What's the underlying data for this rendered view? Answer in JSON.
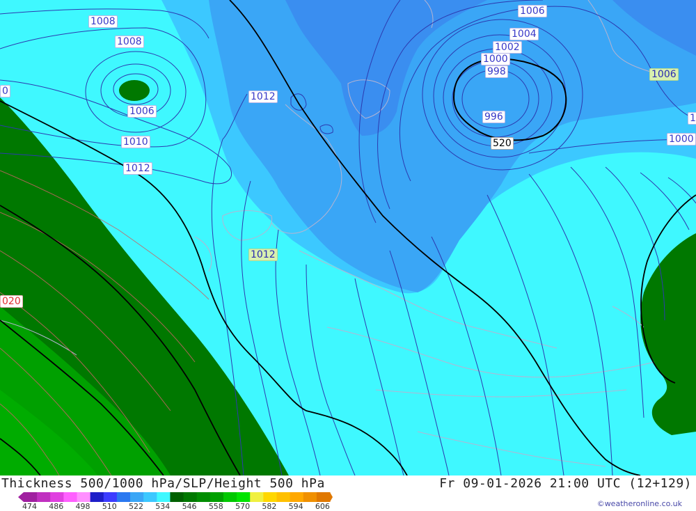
{
  "map": {
    "pressure_labels": [
      {
        "text": "1008",
        "style": "plain"
      },
      {
        "text": "1008",
        "style": "plain"
      },
      {
        "text": "1006",
        "style": "plain"
      },
      {
        "text": "1010",
        "style": "plain"
      },
      {
        "text": "1012",
        "style": "plain"
      },
      {
        "text": "1012",
        "style": "plain"
      },
      {
        "text": "1012",
        "style": "pale"
      },
      {
        "text": "1006",
        "style": "plain"
      },
      {
        "text": "1004",
        "style": "plain"
      },
      {
        "text": "1002",
        "style": "plain"
      },
      {
        "text": "1000",
        "style": "plain"
      },
      {
        "text": "998",
        "style": "plain"
      },
      {
        "text": "996",
        "style": "plain"
      },
      {
        "text": "1006",
        "style": "pale"
      },
      {
        "text": "1000",
        "style": "plain"
      },
      {
        "text": "0",
        "style": "plain"
      },
      {
        "text": "1",
        "style": "plain"
      }
    ],
    "thickness_labels": [
      {
        "text": "520",
        "style": "thick"
      },
      {
        "text": "020",
        "style": "red"
      }
    ],
    "colors": {
      "cyan": "#3ff8ff",
      "light_blue": "#3cc8ff",
      "mid_blue": "#3aa6f6",
      "blue": "#3a8ef0",
      "dark_green": "#007800",
      "green": "#00a000",
      "isobar": "#2c3ab0",
      "thickness_line": "#000000",
      "height_line": "#c86464",
      "coast": "#b4b4d2"
    }
  },
  "footer": {
    "title": "Thickness 500/1000 hPa/SLP/Height 500 hPa",
    "valid_time": "Fr 09-01-2026 21:00 UTC (12+129)",
    "credit": "©weatheronline.co.uk"
  },
  "legend": {
    "colors": [
      "#a020a0",
      "#c030c0",
      "#e040e0",
      "#ff60ff",
      "#ff90ff",
      "#1e1ec8",
      "#3c3cff",
      "#2a78f0",
      "#3aa6f6",
      "#3cc8ff",
      "#3ff8ff",
      "#006000",
      "#007800",
      "#008c00",
      "#00a000",
      "#00c800",
      "#00e400",
      "#f0f040",
      "#ffd700",
      "#ffc000",
      "#ffa800",
      "#f09000",
      "#e07800"
    ],
    "ticks": [
      "474",
      "486",
      "498",
      "510",
      "522",
      "534",
      "546",
      "558",
      "570",
      "582",
      "594",
      "606"
    ]
  }
}
